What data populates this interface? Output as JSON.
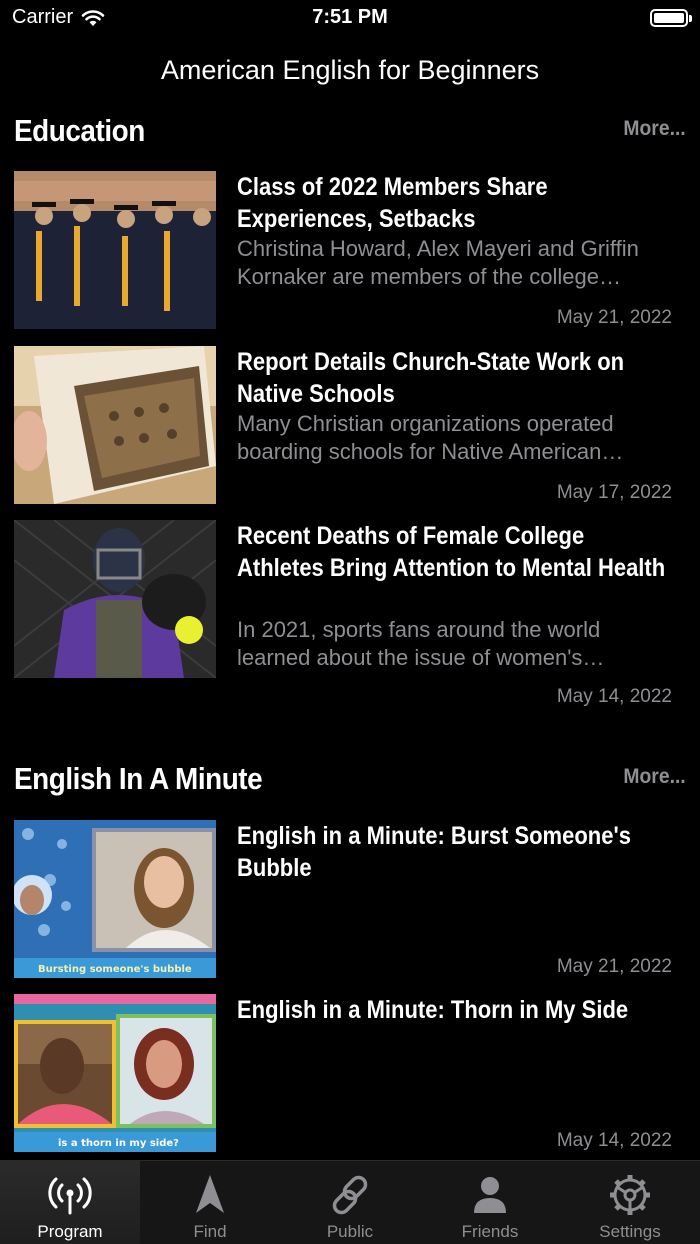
{
  "status": {
    "carrier": "Carrier",
    "time": "7:51 PM"
  },
  "nav": {
    "title": "American English for Beginners"
  },
  "sections": [
    {
      "title": "Education",
      "more": "More...",
      "articles": [
        {
          "title": "Class of 2022 Members Share Experiences, Setbacks",
          "description": "Christina Howard, Alex Mayeri and Griffin Kornaker are members of the college…",
          "date": "May 21, 2022"
        },
        {
          "title": "Report Details Church-State Work on Native Schools",
          "description": "Many Christian organizations operated boarding schools for Native American…",
          "date": "May 17, 2022"
        },
        {
          "title": "Recent Deaths of Female College Athletes Bring Attention to Mental Health",
          "description": "In 2021, sports fans around the world learned about the issue of women's…",
          "date": "May 14, 2022"
        }
      ]
    },
    {
      "title": "English In A Minute",
      "more": "More...",
      "articles": [
        {
          "title": "English in a Minute: Burst Someone's Bubble",
          "caption": "Bursting someone's bubble",
          "date": "May 21, 2022"
        },
        {
          "title": "English in a Minute: Thorn in My Side",
          "caption": "is a thorn in my side?",
          "date": "May 14, 2022"
        }
      ]
    }
  ],
  "tabs": [
    {
      "label": "Program",
      "icon": "antenna-icon",
      "active": true
    },
    {
      "label": "Find",
      "icon": "navigation-arrow-icon",
      "active": false
    },
    {
      "label": "Public",
      "icon": "link-icon",
      "active": false
    },
    {
      "label": "Friends",
      "icon": "person-icon",
      "active": false
    },
    {
      "label": "Settings",
      "icon": "gear-icon",
      "active": false
    }
  ],
  "colors": {
    "background": "#000000",
    "secondary_text": "#8e8e93",
    "tab_bar": "#161616"
  }
}
